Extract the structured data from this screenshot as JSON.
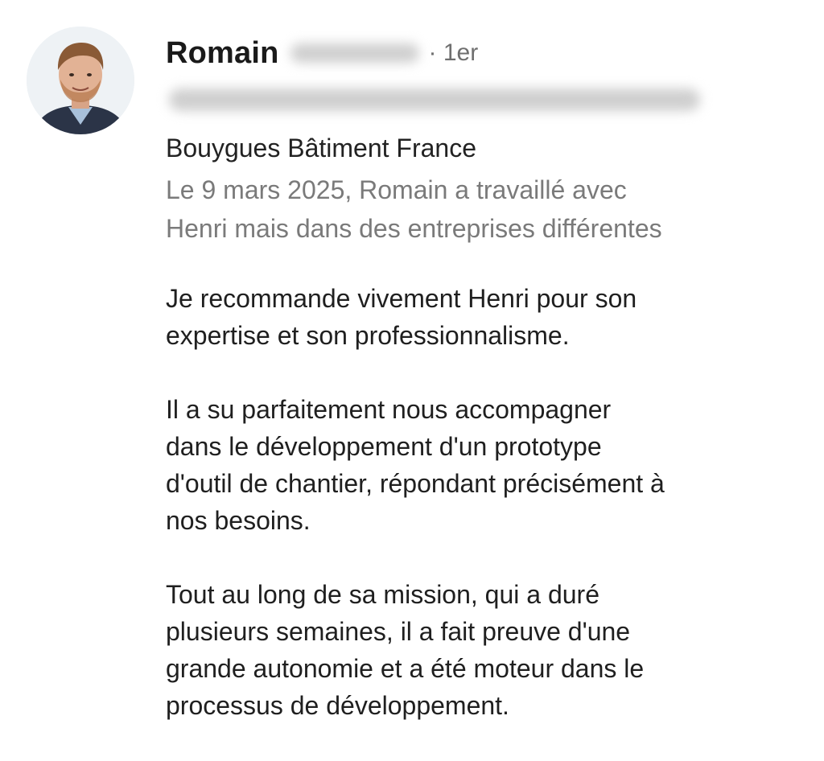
{
  "recommendation": {
    "author_first_name": "Romain",
    "connection_degree": "· 1er",
    "company": "Bouygues Bâtiment France",
    "relation_line_1": "Le 9 mars 2025, Romain a travaillé avec",
    "relation_line_2": "Henri mais dans des entreprises différentes",
    "paragraphs": [
      "Je recommande vivement Henri pour son\nexpertise et son professionnalisme.",
      "Il a su parfaitement nous accompagner\ndans le développement d'un prototype\nd'outil de chantier, répondant précisément à\nnos besoins.",
      "Tout au long de sa mission, qui a duré\nplusieurs semaines, il a fait preuve d'une\ngrande autonomie et a été moteur dans le\nprocessus de développement."
    ]
  },
  "icons": {
    "avatar": "profile-photo"
  },
  "colors": {
    "text_primary": "#1f1f1f",
    "text_secondary": "#7a7a7a",
    "background": "#ffffff"
  }
}
